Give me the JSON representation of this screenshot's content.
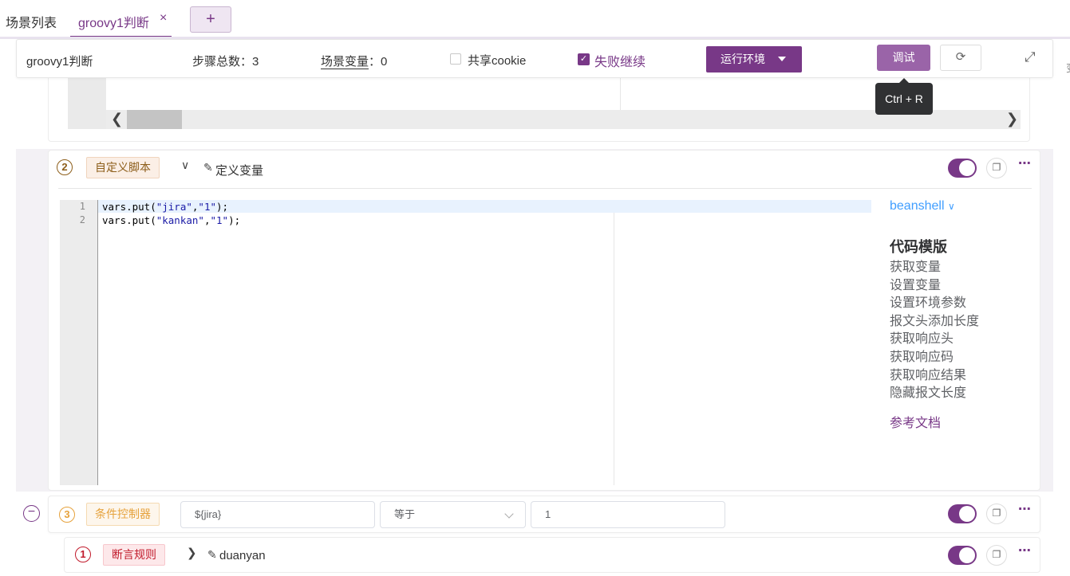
{
  "tabs": {
    "list_label": "场景列表",
    "active_label": "groovy1判断",
    "close_glyph": "×",
    "add_glyph": "+"
  },
  "header": {
    "name": "groovy1判断",
    "steps_label": "步骤总数",
    "steps_value": "3",
    "vars_label": "场景变量",
    "vars_value": "0",
    "share_cookie_label": "共享cookie",
    "share_cookie_checked": false,
    "fail_continue_label": "失败继续",
    "fail_continue_checked": true,
    "env_button_label": "运行环境",
    "debug_button_label": "调试",
    "tooltip": "Ctrl + R",
    "edge_char": "变"
  },
  "steps": [
    {
      "index": "2",
      "type_label": "自定义脚本",
      "name": "定义变量",
      "enabled": true,
      "code_lines": [
        {
          "no": "1",
          "text": "vars.put(\"jira\",\"1\");"
        },
        {
          "no": "2",
          "text": "vars.put(\"kankan\",\"1\");"
        }
      ],
      "language": "beanshell",
      "template": {
        "title": "代码模版",
        "items": [
          "获取变量",
          "设置变量",
          "设置环境参数",
          "报文头添加长度",
          "获取响应头",
          "获取响应码",
          "获取响应结果",
          "隐藏报文长度"
        ],
        "doc_link": "参考文档"
      }
    },
    {
      "index": "3",
      "type_label": "条件控制器",
      "variable": "${jira}",
      "operator": "等于",
      "value": "1",
      "enabled": true,
      "children": [
        {
          "index": "1",
          "type_label": "断言规则",
          "name": "duanyan",
          "enabled": true
        }
      ]
    }
  ],
  "colors": {
    "primary": "#783887",
    "script_tag": "#8d5e1a",
    "controller_tag": "#e6a23c",
    "assertion_tag": "#c11a2b",
    "link_blue": "#409eff"
  }
}
